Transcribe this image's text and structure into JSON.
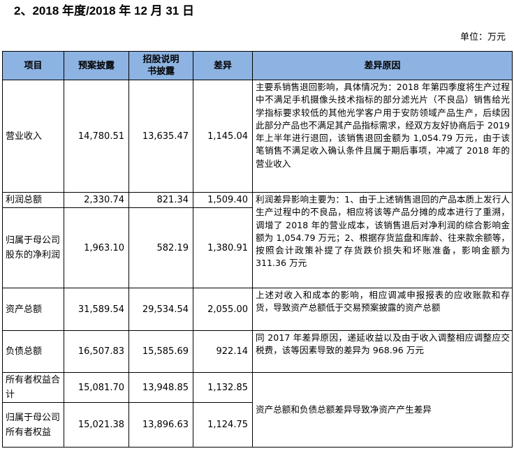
{
  "heading": "2、2018 年度/2018 年 12 月 31 日",
  "unit": "单位：万元",
  "table": {
    "headers": [
      "项目",
      "预案披露",
      "招股说明书披露",
      "差异",
      "差异原因"
    ],
    "rows": [
      {
        "item": "营业收入",
        "plan": "14,780.51",
        "prospectus": "13,635.47",
        "diff": "1,145.04",
        "reason": "主要系销售退回影响，具体情况为：2018 年第四季度将生产过程中不满足手机摄像头技术指标的部分滤光片（不良品）销售给光学指标要求较低的其他光学客户用于安防领域产品生产，后续因此部分产品也不满足其产品指标需求，经双方友好协商后于 2019 年上半年进行退回，该销售退回金额为 1,054.79 万元，由于该笔销售不满足收入确认条件且属于期后事项，冲减了 2018 年的营业收入"
      },
      {
        "item": "利润总额",
        "plan": "2,330.74",
        "prospectus": "821.34",
        "diff": "1,509.40",
        "reason": "利润差异影响主要为：1、由于上述销售退回的产品本质上发行人生产过程中的不良品，相应将该等产品分摊的成本进行了重溯，调增了 2018 年的营业成本，该销售退后对净利润的综合影响金额为 1,054.79 万元；2、根据存货监盘和库龄、往来款余额等，按照会计政策补提了存货跌价损失和坏账准备，影响金额为 311.36 万元"
      },
      {
        "item": "归属于母公司股东的净利润",
        "plan": "1,963.10",
        "prospectus": "582.19",
        "diff": "1,380.91"
      },
      {
        "item": "资产总额",
        "plan": "31,589.54",
        "prospectus": "29,534.54",
        "diff": "2,055.00",
        "reason": "上述对收入和成本的影响，相应调减申报报表的应收账款和存货，导致资产总额低于交易预案披露的资产总额"
      },
      {
        "item": "负债总额",
        "plan": "16,507.83",
        "prospectus": "15,585.69",
        "diff": "922.14",
        "reason": "同 2017 年差异原因，递延收益以及由于收入调整相应调整应交税费，该等因素导致的差异为 968.96 万元"
      },
      {
        "item": "所有者权益合计",
        "plan": "15,081.70",
        "prospectus": "13,948.85",
        "diff": "1,132.85",
        "reason": "资产总额和负债总额差异导致净资产产生差异"
      },
      {
        "item": "归属于母公司所有者权益",
        "plan": "15,021.38",
        "prospectus": "13,896.63",
        "diff": "1,124.75"
      }
    ]
  }
}
